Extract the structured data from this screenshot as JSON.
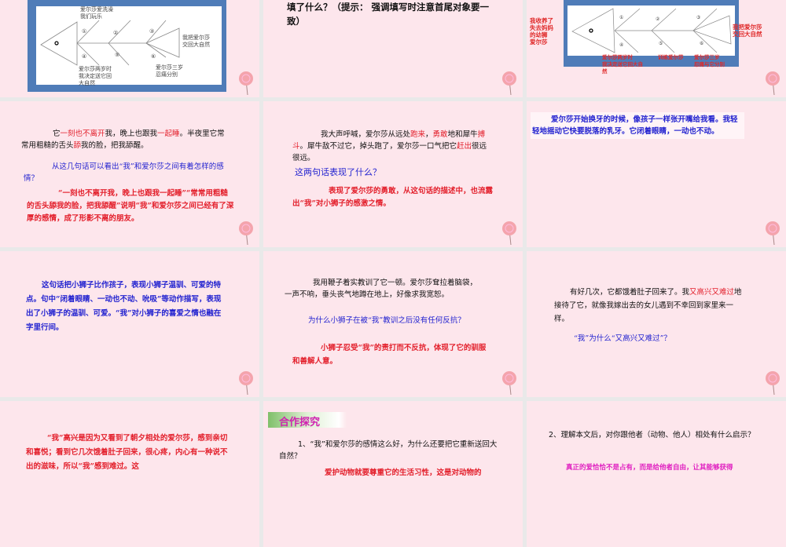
{
  "slides": [
    {
      "id": 1,
      "fishbone": {
        "top_label": "爱尔莎爱洗澡\n我们玩乐",
        "right_label": "我把爱尔莎\n交回大自然",
        "bottom_left_label": "爱尔莎两岁时\n我决定送它回\n大自然",
        "bottom_right_label": "爱尔莎三岁\n忍痛分别",
        "numbers": [
          "①",
          "②",
          "③",
          "④",
          "⑤",
          "⑥"
        ]
      }
    },
    {
      "id": 2,
      "text": "填了什么？（提示：  强调填写时注意首尾对象要一致）"
    },
    {
      "id": 3,
      "fishbone": {
        "left_label": "我收养了\n失去妈妈\n的幼狮\n爱尔莎",
        "right_label": "我把爱尔莎\n交回大自然",
        "bottom_left_label": "爱尔莎两岁时\n我决定送它回大自\n然",
        "bottom_middle_label": "训练爱尔莎",
        "bottom_right_label": "爱尔莎三岁\n忍痛与它分别",
        "numbers": [
          "①",
          "②",
          "③",
          "④",
          "⑤",
          "⑥"
        ]
      }
    },
    {
      "id": 4,
      "passage": [
        {
          "t": "它"
        },
        {
          "t": "一刻也不离开",
          "em": true
        },
        {
          "t": "我，晚上也跟我"
        },
        {
          "t": "一起睡",
          "em": true
        },
        {
          "t": "。半夜里它常常用粗糙的舌头"
        },
        {
          "t": "舔",
          "em": true
        },
        {
          "t": "我的脸，把我舔醒。"
        }
      ],
      "question": "从这几句话可以看出“我”和爱尔莎之间有着怎样的感情？",
      "answer": "“一刻也不离开我，晚上也跟我一起睡”“常常用粗糙的舌头舔我的脸，把我舔醒”说明“我”和爱尔莎之间已经有了深厚的感情，成了形影不离的朋友。"
    },
    {
      "id": 5,
      "passage": [
        {
          "t": "我大声呼喊，爱尔莎从远处"
        },
        {
          "t": "跑来",
          "em": true
        },
        {
          "t": "，"
        },
        {
          "t": "勇敢",
          "em": true
        },
        {
          "t": "地和犀牛"
        },
        {
          "t": "搏斗",
          "em": true
        },
        {
          "t": "。犀牛敌不过它，掉头跑了，爱尔莎一口气把它"
        },
        {
          "t": "赶出",
          "em": true
        },
        {
          "t": "很远很远。"
        }
      ],
      "question": "这两句话表现了什么？",
      "answer": "表现了爱尔莎的勇敢，从这句话的描述中，也流露出“我”对小狮子的感激之情。"
    },
    {
      "id": 6,
      "passage_text": "爱尔莎开始换牙的时候，像孩子一样张开嘴给我看。我轻轻地摇动它快要脱落的乳牙。它闭着眼睛，一动也不动。"
    },
    {
      "id": 7,
      "analysis": "这句话把小狮子比作孩子，表现小狮子温驯、可爱的特点。句中“闭着眼睛、一动也不动、吮吸”等动作描写，表现出了小狮子的温驯、可爱。“我”对小狮子的喜爱之情也融在字里行间。"
    },
    {
      "id": 8,
      "passage_text": "我用鞭子着实教训了它一顿。爱尔莎耷拉着脑袋，一声不响，垂头丧气地蹲在地上，好像求我宽恕。",
      "question": "为什么小狮子在被“我”教训之后没有任何反抗？",
      "answer": "小狮子忍受“我”的责打而不反抗，体现了它的驯服和善解人意。"
    },
    {
      "id": 9,
      "passage": [
        {
          "t": "有好几次，它都饿着肚子回来了。我"
        },
        {
          "t": "又高兴又难过",
          "em": true
        },
        {
          "t": "地接待了它，就像我嫁出去的女儿遇到不幸回到家里来一样。"
        }
      ],
      "question": "“我”为什么“又高兴又难过”？"
    },
    {
      "id": 10,
      "answer": "“我”高兴是因为又看到了朝夕相处的爱尔莎，感到亲切和喜悦；看到它几次饿着肚子回来，很心疼，内心有一种说不出的滋味，所以“我”感到难过。这"
    },
    {
      "id": 11,
      "section_tag": "合作探究",
      "question": "1、“我”和爱尔莎的感情这么好，为什么还要把它重新送回大自然？",
      "answer_partial": "爱护动物就要尊重它的生活习性，这是对动物的"
    },
    {
      "id": 12,
      "question": "2、理解本文后，对你跟他者（动物、他人）相处有什么启示？",
      "answer_partial": "真正的爱恰恰不是占有，而是给他者自由，让其能够获得"
    }
  ],
  "colors": {
    "slide_bg": "#fde6ec",
    "frame": "#4f7cb8",
    "emphasis": "#e3202c",
    "question": "#2323d0",
    "magenta": "#e020c0"
  }
}
